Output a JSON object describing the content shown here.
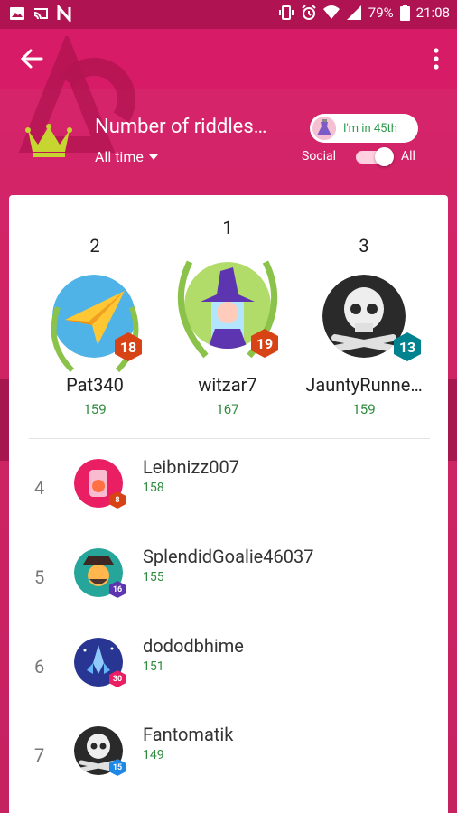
{
  "status_bar": {
    "battery": "79%",
    "time": "21:08",
    "icons": [
      "image-icon",
      "cast-icon",
      "n-icon",
      "vibrate-icon",
      "alarm-icon",
      "wifi-icon",
      "signal-icon",
      "battery-icon"
    ]
  },
  "app_bar": {
    "back_icon": "arrow-back-icon",
    "menu_icon": "more-vert-icon"
  },
  "leaderboard": {
    "title": "Number of riddles…",
    "time_filter": "All time",
    "my_rank": "I'm in 45th",
    "toggle": {
      "left_label": "Social",
      "right_label": "All",
      "selected": "All"
    }
  },
  "podium": [
    {
      "rank": "2",
      "name": "Pat340",
      "score": "159",
      "level": "18",
      "badge_color": "#d84315"
    },
    {
      "rank": "1",
      "name": "witzar7",
      "score": "167",
      "level": "19",
      "badge_color": "#d84315"
    },
    {
      "rank": "3",
      "name": "JauntyRunne…",
      "score": "159",
      "level": "13",
      "badge_color": "#00838f"
    }
  ],
  "list": [
    {
      "rank": "4",
      "name": "Leibnizz007",
      "score": "158",
      "level": "8",
      "badge_color": "#d84315"
    },
    {
      "rank": "5",
      "name": "SplendidGoalie46037",
      "score": "155",
      "level": "16",
      "badge_color": "#5e35b1"
    },
    {
      "rank": "6",
      "name": "dododbhime",
      "score": "151",
      "level": "30",
      "badge_color": "#e91e63"
    },
    {
      "rank": "7",
      "name": "Fantomatik",
      "score": "149",
      "level": "15",
      "badge_color": "#1e88e5"
    }
  ],
  "colors": {
    "accent": "#d81b66",
    "score_green": "#2e8b3d",
    "crown": "#c6d530"
  }
}
